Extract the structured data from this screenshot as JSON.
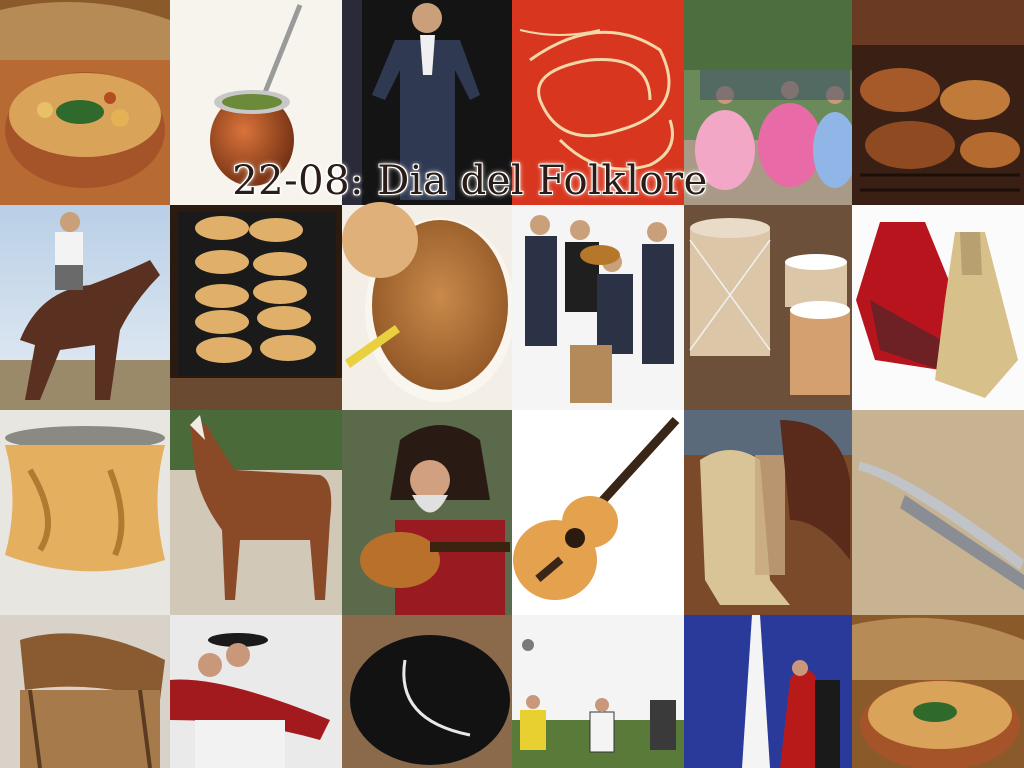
{
  "title": "22-08: Dia del Folklore"
}
